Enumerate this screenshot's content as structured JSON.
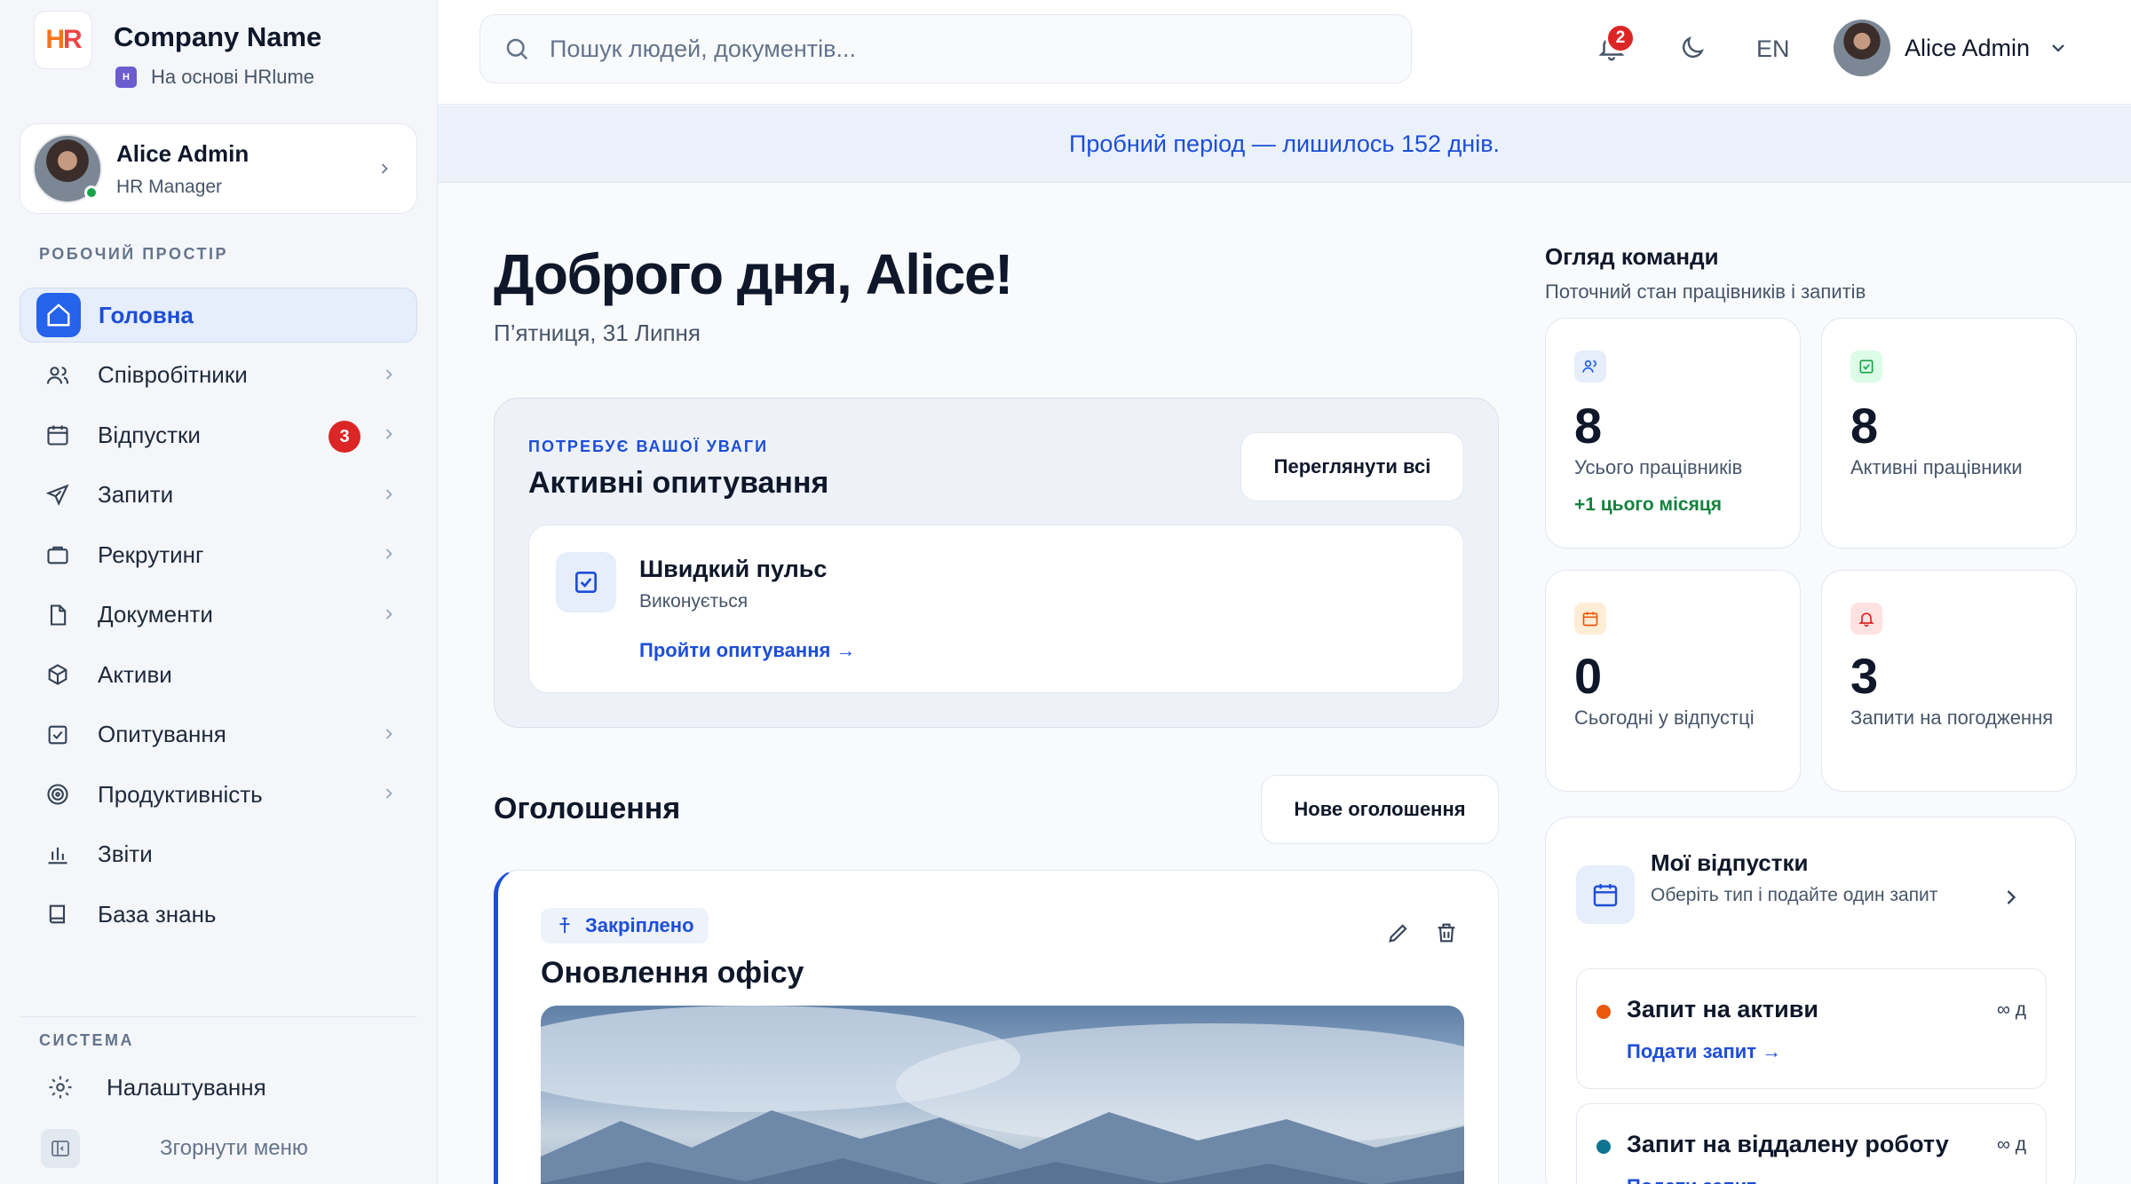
{
  "brand": {
    "logo_h": "H",
    "logo_r": "R",
    "name": "Company Name",
    "powered_by": "На основі HRlume"
  },
  "sidebar_user": {
    "name": "Alice Admin",
    "role": "HR Manager"
  },
  "sidebar": {
    "workspace_label": "РОБОЧИЙ ПРОСТІР",
    "items": [
      {
        "label": "Головна",
        "icon": "home-icon",
        "active": true
      },
      {
        "label": "Співробітники",
        "icon": "users-icon",
        "has_arrow": true
      },
      {
        "label": "Відпустки",
        "icon": "calendar-icon",
        "has_arrow": true,
        "badge": "3"
      },
      {
        "label": "Запити",
        "icon": "send-icon",
        "has_arrow": true
      },
      {
        "label": "Рекрутинг",
        "icon": "briefcase-icon",
        "has_arrow": true
      },
      {
        "label": "Документи",
        "icon": "document-icon",
        "has_arrow": true
      },
      {
        "label": "Активи",
        "icon": "box-icon"
      },
      {
        "label": "Опитування",
        "icon": "checkbox-icon",
        "has_arrow": true
      },
      {
        "label": "Продуктивність",
        "icon": "target-icon",
        "has_arrow": true
      },
      {
        "label": "Звіти",
        "icon": "bar-chart-icon"
      },
      {
        "label": "База знань",
        "icon": "book-icon"
      }
    ],
    "system_label": "СИСТЕМА",
    "settings_label": "Налаштування",
    "collapse_label": "Згорнути меню"
  },
  "topbar": {
    "search_placeholder": "Пошук людей, документів...",
    "notifications_count": "2",
    "language": "EN",
    "user_name": "Alice Admin"
  },
  "trial_banner": "Пробний період — лишилось 152 днів.",
  "greeting": {
    "title": "Доброго дня, Alice!",
    "date": "П’ятниця, 31 Липня"
  },
  "attention": {
    "eyebrow": "ПОТРЕБУЄ ВАШОЇ УВАГИ",
    "title": "Активні опитування",
    "view_all": "Переглянути всі",
    "survey": {
      "title": "Швидкий пульс",
      "status": "Виконується",
      "link": "Пройти опитування →"
    }
  },
  "announcements": {
    "title": "Оголошення",
    "new_button": "Нове оголошення",
    "pinned_label": "Закріплено",
    "item_title": "Оновлення офісу"
  },
  "team": {
    "title": "Огляд команди",
    "subtitle": "Поточний стан працівників і запитів",
    "stats": [
      {
        "value": "8",
        "label": "Усього працівників",
        "delta": "+1 цього місяця",
        "icon": "users-icon",
        "color": "#2563eb",
        "bg": "#e6edfb"
      },
      {
        "value": "8",
        "label": "Активні працівники",
        "icon": "check-square-icon",
        "color": "#16a34a",
        "bg": "#dcfce7"
      },
      {
        "value": "0",
        "label": "Сьогодні у відпустці",
        "icon": "calendar-icon",
        "color": "#ea580c",
        "bg": "#ffedd5"
      },
      {
        "value": "3",
        "label": "Запити на погодження",
        "icon": "bell-icon",
        "color": "#dc2626",
        "bg": "#fee2e2"
      }
    ]
  },
  "my_leave": {
    "title": "Мої відпустки",
    "subtitle": "Оберіть тип і подайте один запит",
    "requests": [
      {
        "title": "Запит на активи",
        "limit": "∞ д",
        "link": "Подати запит →",
        "dot": "#ea580c"
      },
      {
        "title": "Запит на віддалену роботу",
        "limit": "∞ д",
        "link": "Подати запит →",
        "dot": "#0e7490"
      }
    ]
  }
}
